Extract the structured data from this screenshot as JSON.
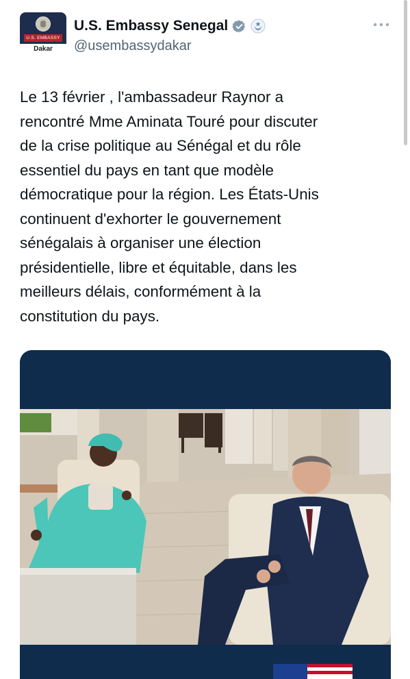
{
  "account": {
    "display_name": "U.S. Embassy Senegal",
    "handle": "@usembassydakar",
    "avatar_banner_text": "U.S. EMBASSY",
    "avatar_city": "Dakar",
    "verified_icon": "verified-badge-icon",
    "affiliation_icon": "government-seal-icon"
  },
  "tweet": {
    "text_lines": [
      "Le 13 février , l'ambassadeur Raynor a",
      "rencontré Mme Aminata Touré pour discuter",
      "de la crise politique au Sénégal et du rôle",
      "essentiel du pays en tant que modèle",
      "démocratique pour la région. Les États-Unis",
      "continuent d'exhorter le gouvernement",
      "sénégalais à organiser une élection",
      "présidentielle, libre et équitable, dans les",
      "meilleurs délais, conformément à la",
      "constitution du pays."
    ]
  },
  "media": {
    "header_color": "#0f2c4c",
    "icon": "photo-meeting-image"
  },
  "colors": {
    "text": "#0f1419",
    "secondary_text": "#536471",
    "verified_badge": "#829aab",
    "embassy_navy": "#1e2d4d",
    "embassy_red": "#b4232a"
  },
  "menu_icon": "more-options-icon"
}
